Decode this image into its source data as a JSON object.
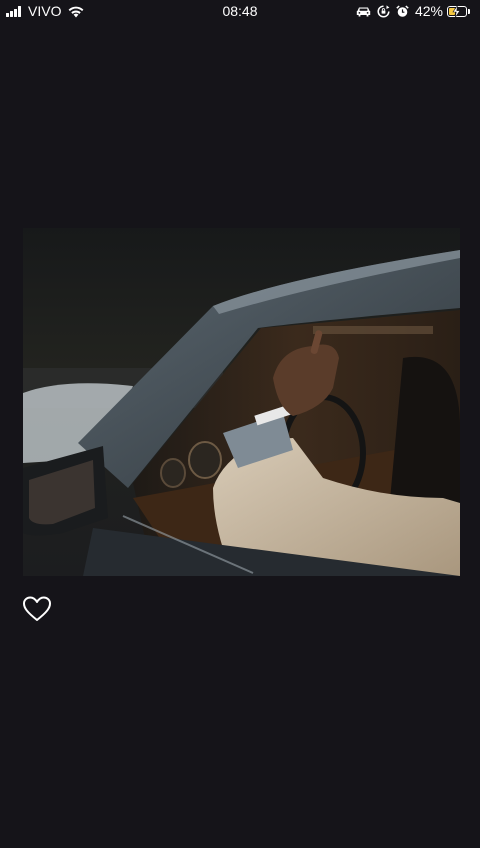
{
  "status_bar": {
    "carrier": "VIVO",
    "time": "08:48",
    "battery_percent": "42%",
    "battery_level": 0.42,
    "signal_icon": "signal-bars-icon",
    "wifi_icon": "wifi-icon",
    "car_icon": "car-icon",
    "rotation_lock_icon": "rotation-lock-icon",
    "alarm_icon": "alarm-icon",
    "battery_icon": "battery-charging-icon"
  },
  "post": {
    "media_icon": "photo-car-driver",
    "like_icon": "heart-outline-icon"
  },
  "colors": {
    "background": "#151419",
    "battery_fill": "#f5c842",
    "icon": "#ffffff"
  }
}
